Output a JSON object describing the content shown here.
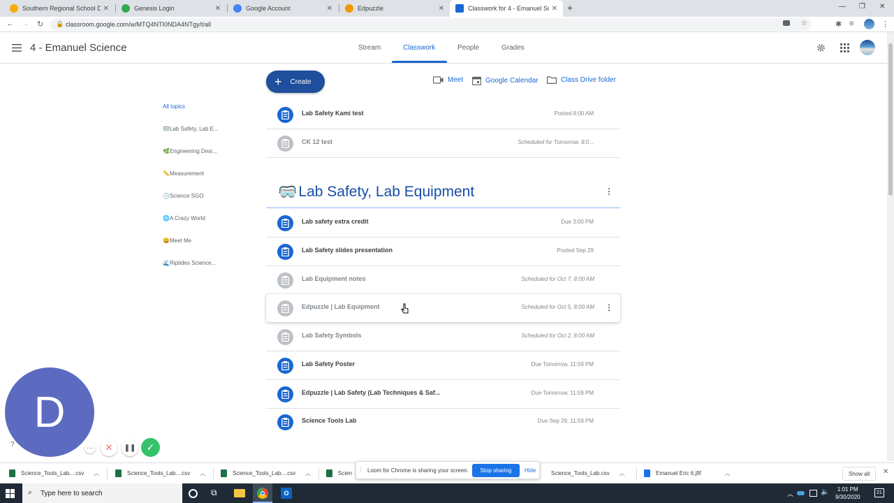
{
  "browser": {
    "tabs": [
      {
        "title": "Southern Regional School Distric",
        "color": "#f9ab00"
      },
      {
        "title": "Genesis Login",
        "color": "#34a853"
      },
      {
        "title": "Google Account",
        "color": "#4285f4"
      },
      {
        "title": "Edpuzzle",
        "color": "#f29900"
      },
      {
        "title": "Classwork for 4 - Emanuel Scienc",
        "color": "#1967d2"
      }
    ],
    "new_tab": "+",
    "url": "classroom.google.com/w/MTQ4NTI0NDA4NTgy/t/all"
  },
  "app": {
    "class_name": "4 - Emanuel Science",
    "nav": [
      "Stream",
      "Classwork",
      "People",
      "Grades"
    ],
    "create_label": "Create",
    "actions": {
      "meet": "Meet",
      "calendar": "Google Calendar",
      "drive": "Class Drive folder"
    }
  },
  "topics": [
    {
      "emoji": "🥽",
      "label": "All topics"
    },
    {
      "emoji": "🥽",
      "label": "Lab Safety, Lab E..."
    },
    {
      "emoji": "🌿",
      "label": "Engineering Desi..."
    },
    {
      "emoji": "📏",
      "label": "Measurement"
    },
    {
      "emoji": "🕒",
      "label": "Science SGO"
    },
    {
      "emoji": "🌐",
      "label": "A Crazy World"
    },
    {
      "emoji": "😀",
      "label": "Meet Me"
    },
    {
      "emoji": "🌊",
      "label": "Riptides Science..."
    }
  ],
  "no_topic_items": [
    {
      "title": "Lab Safety Kami test",
      "status": "Posted 8:00 AM",
      "scheduled": false
    },
    {
      "title": "CK 12 test",
      "status": "Scheduled for Tomorrow, 8:0...",
      "scheduled": true
    }
  ],
  "section": {
    "emoji": "🥽",
    "title": "Lab Safety, Lab Equipment",
    "items": [
      {
        "title": "Lab safety extra credit",
        "status": "Due 3:00 PM",
        "scheduled": false
      },
      {
        "title": "Lab Safety slides presentation",
        "status": "Posted Sep 29",
        "scheduled": false
      },
      {
        "title": "Lab Equipment notes",
        "status": "Scheduled for Oct 7, 8:00 AM",
        "scheduled": true
      },
      {
        "title": "Edpuzzle | Lab Equipment",
        "status": "Scheduled for Oct 5, 8:00 AM",
        "scheduled": true
      },
      {
        "title": "Lab Safety Symbols",
        "status": "Scheduled for Oct 2, 8:00 AM",
        "scheduled": true
      },
      {
        "title": "Lab Safety Poster",
        "status": "Due Tomorrow, 11:59 PM",
        "scheduled": false
      },
      {
        "title": "Edpuzzle | Lab Safety (Lab Techniques & Saf...",
        "status": "Due Tomorrow, 11:59 PM",
        "scheduled": false
      },
      {
        "title": "Science Tools Lab",
        "status": "Due Sep 29, 11:59 PM",
        "scheduled": false
      }
    ]
  },
  "loom": {
    "avatar_letter": "D",
    "banner_text": "Loom for Chrome is sharing your screen.",
    "stop_label": "Stop sharing",
    "hide_label": "Hide"
  },
  "downloads": [
    "Science_Tools_Lab....csv",
    "Science_Tools_Lab....csv",
    "Science_Tools_Lab....csv",
    "Scien",
    "Science_Tools_Lab.csv",
    "Emanuel Eric 6.jfif"
  ],
  "show_all": "Show all",
  "taskbar": {
    "search_placeholder": "Type here to search",
    "time": "1:01 PM",
    "date": "9/30/2020",
    "notifications": "21"
  }
}
